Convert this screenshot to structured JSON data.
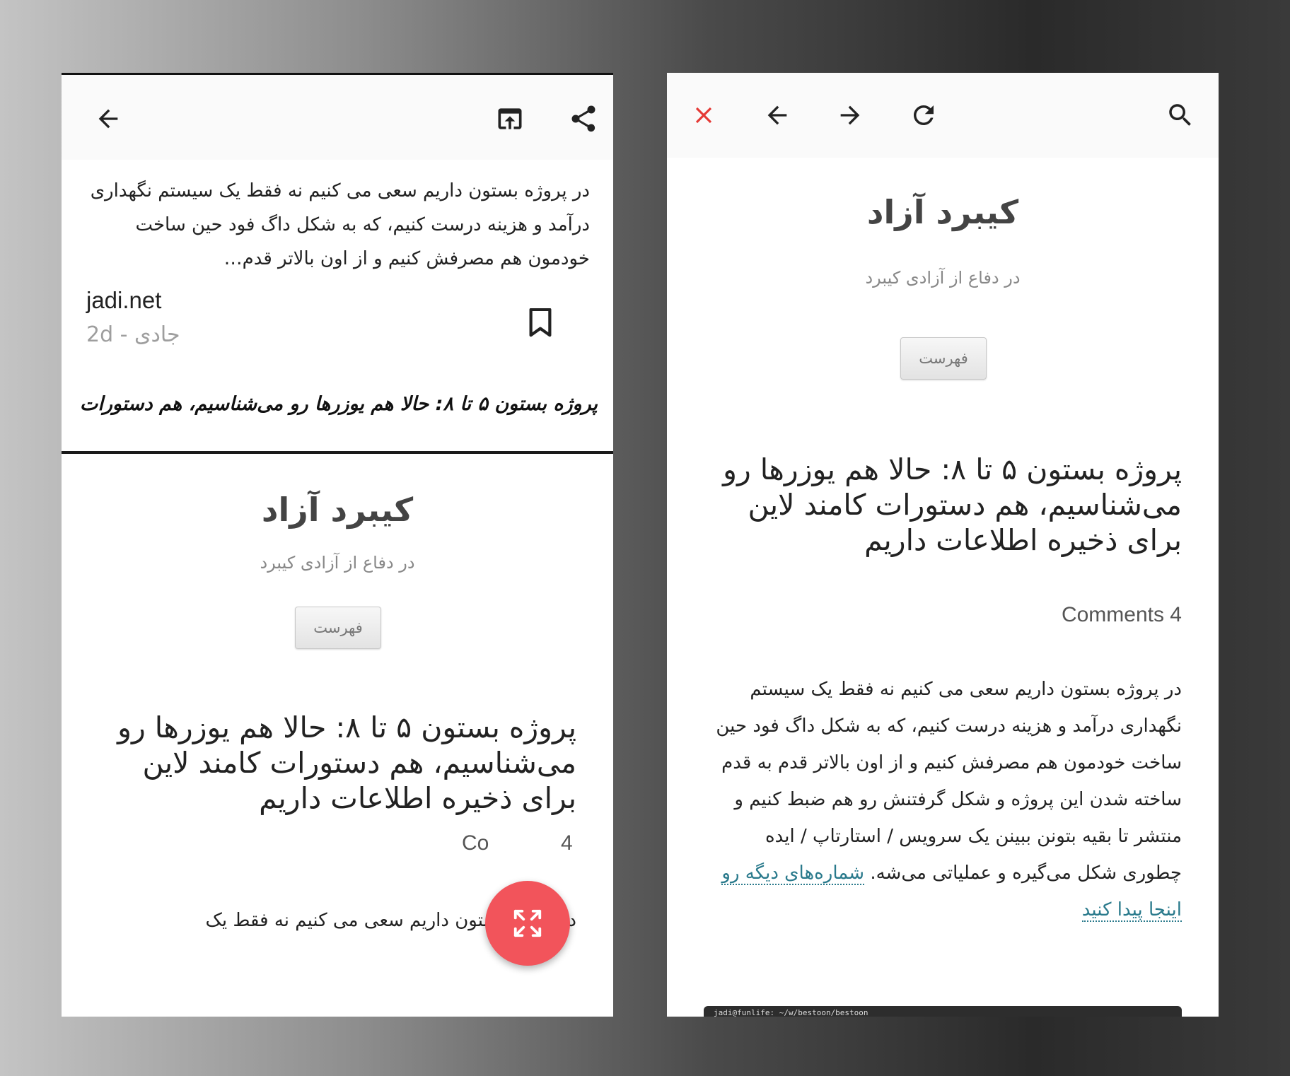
{
  "left": {
    "toolbar": {
      "back_icon": "arrow-back-icon",
      "open_icon": "open-in-browser-icon",
      "share_icon": "share-icon"
    },
    "feed_item": {
      "excerpt": "در پروژه بستون داریم سعی می کنیم نه فقط یک سیستم نگهداری درآمد و هزینه درست کنیم، که به شکل داگ فود حین ساخت خودمون هم مصرفش کنیم و از اون بالاتر قدم…",
      "source": "jadi.net",
      "meta": "جادی - 2d",
      "bookmark_icon": "bookmark-icon"
    },
    "ticker": "پروژه بستون ۵ تا ۸: حالا هم یوزرها رو می‌شناسیم، هم دستورات",
    "web": {
      "site_title": "کیبرد آزاد",
      "tagline": "در دفاع از آزادی کیبرد",
      "menu_button": "فهرست",
      "post_title": "پروژه بستون ۵ تا ۸: حالا هم یوزرها رو می‌شناسیم، هم دستورات کامند لاین برای ذخیره اطلاعات داریم",
      "comments": "Comments 4",
      "comments_visible_left": "Co",
      "comments_visible_right": "4",
      "body_first_line": "در پروژه بستون داریم سعی می کنیم نه فقط یک"
    },
    "fab_icon": "fullscreen-icon",
    "fab_color": "#f2545b"
  },
  "right": {
    "browser_bar": {
      "close_icon": "close-icon",
      "back_icon": "arrow-back-icon",
      "forward_icon": "arrow-forward-icon",
      "refresh_icon": "refresh-icon",
      "search_icon": "search-icon",
      "close_color": "#e53935"
    },
    "web": {
      "site_title": "کیبرد آزاد",
      "tagline": "در دفاع از آزادی کیبرد",
      "menu_button": "فهرست",
      "post_title": "پروژه بستون ۵ تا ۸: حالا هم یوزرها رو می‌شناسیم، هم دستورات کامند لاین برای ذخیره اطلاعات داریم",
      "comments": "Comments 4",
      "body": "در پروژه بستون داریم سعی می کنیم نه فقط یک سیستم نگهداری درآمد و هزینه درست کنیم، که به شکل داگ فود حین ساخت خودمون هم مصرفش کنیم و از اون بالاتر قدم به قدم ساخته شدن این پروژه و شکل گرفتنش رو هم ضبط کنیم و منتشر تا بقیه بتونن ببینن یک سرویس / استارتاپ / ایده چطوری شکل می‌گیره و عملیاتی می‌شه.",
      "link_text": "شماره‌های دیگه رو اینجا پیدا کنید",
      "link_color": "#2a7a8c",
      "terminal_title": "jadi@funlife: ~/w/bestoon/bestoon"
    }
  }
}
